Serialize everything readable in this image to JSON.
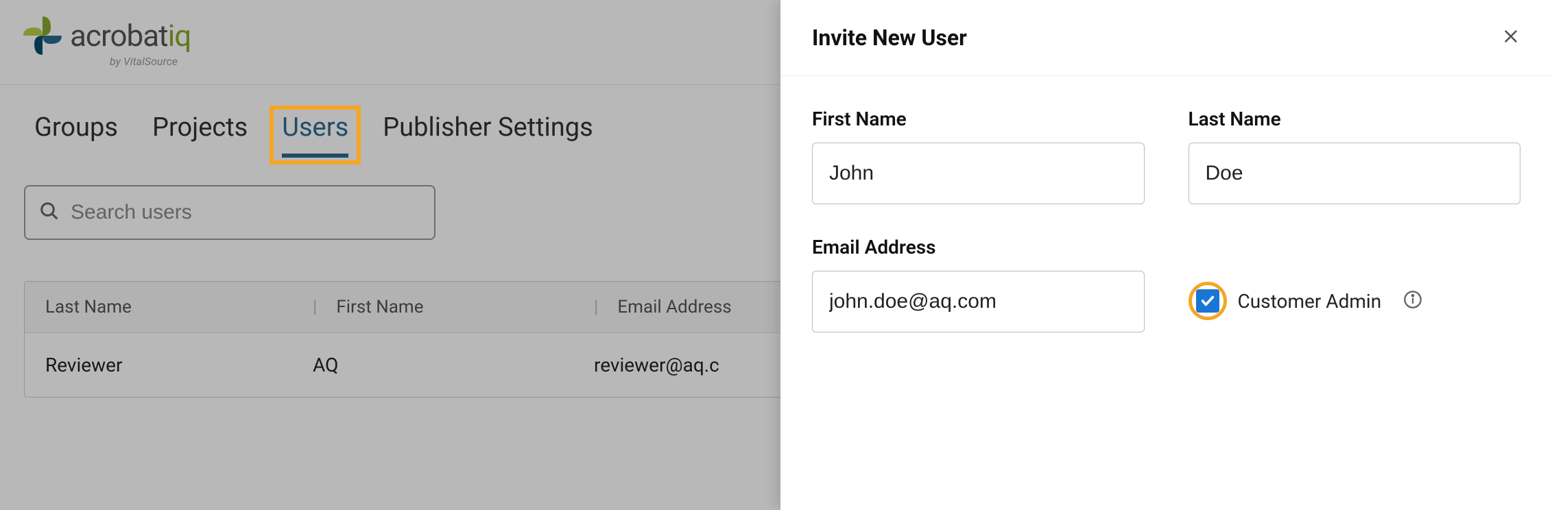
{
  "brand": {
    "name_part1": "acrobat",
    "name_part2": "iq",
    "byline": "by VitalSource"
  },
  "tabs": {
    "groups": "Groups",
    "projects": "Projects",
    "users": "Users",
    "publisher_settings": "Publisher Settings",
    "active": "users"
  },
  "search": {
    "placeholder": "Search users"
  },
  "table": {
    "headers": {
      "last_name": "Last Name",
      "first_name": "First Name",
      "email": "Email Address"
    },
    "rows": [
      {
        "last_name": "Reviewer",
        "first_name": "AQ",
        "email": "reviewer@aq.c"
      }
    ]
  },
  "panel": {
    "title": "Invite New User",
    "first_name_label": "First Name",
    "first_name_value": "John",
    "last_name_label": "Last Name",
    "last_name_value": "Doe",
    "email_label": "Email Address",
    "email_value": "john.doe@aq.com",
    "customer_admin_label": "Customer Admin",
    "customer_admin_checked": true
  }
}
